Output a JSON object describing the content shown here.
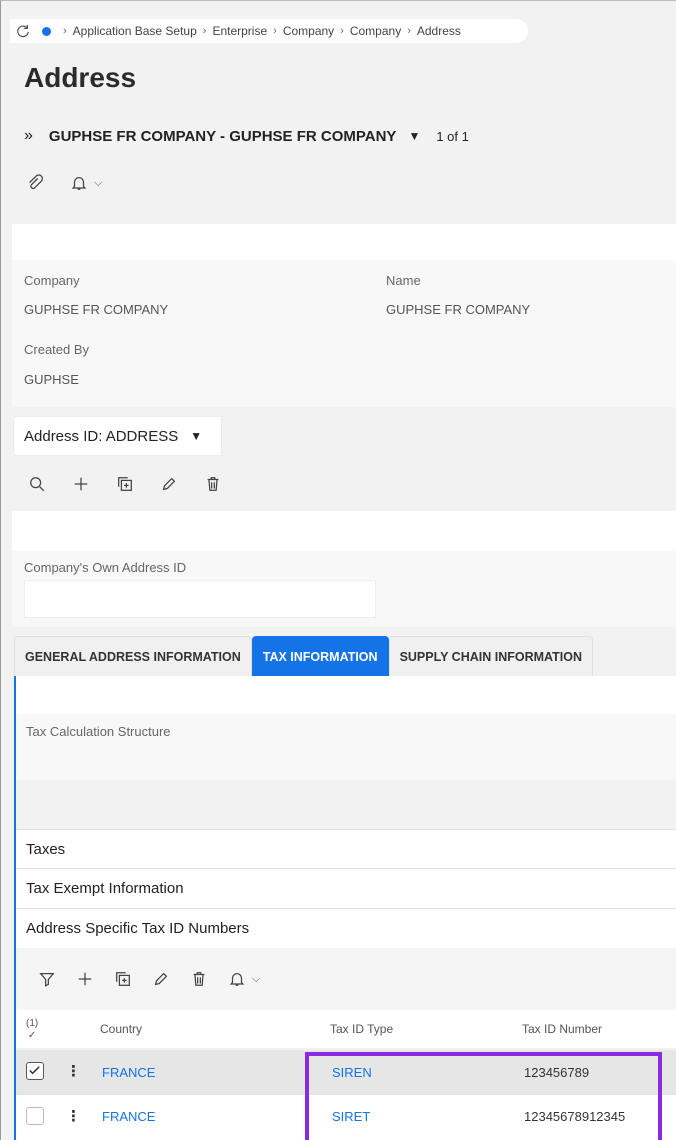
{
  "breadcrumb": {
    "items": [
      "Application Base Setup",
      "Enterprise",
      "Company",
      "Company",
      "Address"
    ]
  },
  "page": {
    "title": "Address"
  },
  "record": {
    "label": "GUPHSE FR COMPANY - GUPHSE FR COMPANY",
    "count": "1 of 1"
  },
  "header_panel": {
    "company_label": "Company",
    "company_value": "GUPHSE FR COMPANY",
    "name_label": "Name",
    "name_value": "GUPHSE FR COMPANY",
    "created_by_label": "Created By",
    "created_by_value": "GUPHSE"
  },
  "address_selector": {
    "label": "Address ID: ADDRESS"
  },
  "own_address": {
    "label": "Company's Own Address ID",
    "value": ""
  },
  "tabs": [
    {
      "label": "GENERAL ADDRESS INFORMATION",
      "active": false
    },
    {
      "label": "TAX INFORMATION",
      "active": true
    },
    {
      "label": "SUPPLY CHAIN INFORMATION",
      "active": false
    }
  ],
  "tax_info": {
    "tax_calc_label": "Tax Calculation Structure",
    "tax_calc_value": ""
  },
  "sections": {
    "taxes": "Taxes",
    "tax_exempt": "Tax Exempt Information",
    "address_tax_ids": "Address Specific Tax ID Numbers"
  },
  "table": {
    "selected_count": "(1)",
    "columns": {
      "country": "Country",
      "tax_id_type": "Tax ID Type",
      "tax_id_number": "Tax ID Number"
    },
    "rows": [
      {
        "country": "FRANCE",
        "tax_id_type": "SIREN",
        "tax_id_number": "123456789",
        "checked": true
      },
      {
        "country": "FRANCE",
        "tax_id_type": "SIRET",
        "tax_id_number": "12345678912345",
        "checked": false
      }
    ]
  },
  "colors": {
    "accent": "#1473e6",
    "highlight": "#8a2be2"
  },
  "icons": [
    "refresh-icon",
    "attachment-icon",
    "bell-icon",
    "search-icon",
    "plus-icon",
    "duplicate-icon",
    "edit-icon",
    "delete-icon",
    "filter-icon"
  ]
}
